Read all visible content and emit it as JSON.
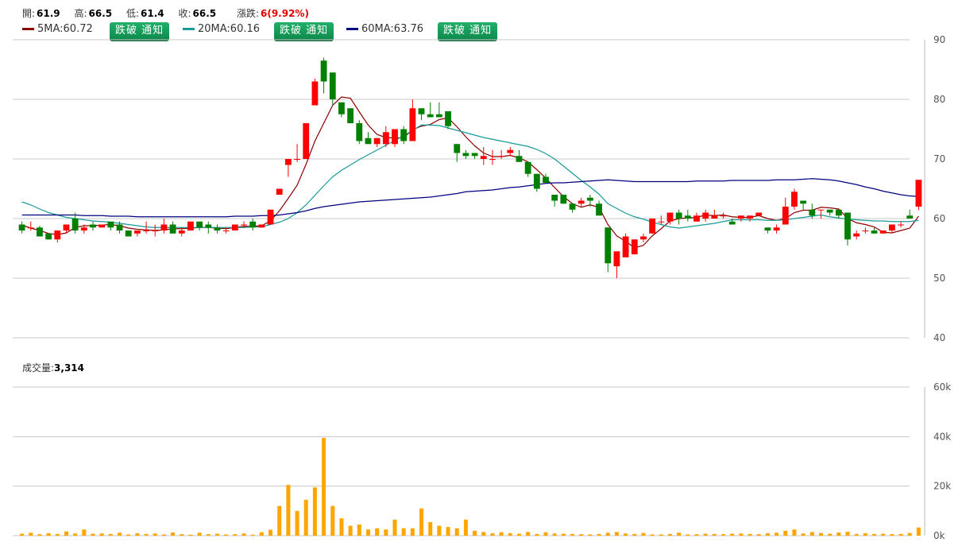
{
  "header": {
    "open_label": "開:",
    "open": "61.9",
    "high_label": "高:",
    "high": "66.5",
    "low_label": "低:",
    "low": "61.4",
    "close_label": "收:",
    "close": "66.5",
    "change_label": "漲跌:",
    "change": "6(9.92%)"
  },
  "ma": [
    {
      "label": "5MA:60.72",
      "color": "#8b0000",
      "button": "跌破 通知"
    },
    {
      "label": "20MA:60.16",
      "color": "#199a9a",
      "button": "跌破 通知"
    },
    {
      "label": "60MA:63.76",
      "color": "#00007f",
      "button": "跌破 通知"
    }
  ],
  "volume_label": "成交量:",
  "volume_value": "3,314",
  "colors": {
    "up": "#ff0000",
    "down": "#008000",
    "volume": "#ffa500",
    "grid": "#c8c8c8"
  },
  "chart_data": [
    {
      "type": "candlestick",
      "ylim": [
        40,
        90
      ],
      "yticks": [
        "90",
        "80",
        "70",
        "60",
        "50",
        "40"
      ],
      "grid": true,
      "candles": [
        [
          59.0,
          59.5,
          57.5,
          58.0
        ],
        [
          58.5,
          59.5,
          58.0,
          58.5
        ],
        [
          58.5,
          58.8,
          57.0,
          57.0
        ],
        [
          57.5,
          57.5,
          56.5,
          56.5
        ],
        [
          56.5,
          58.0,
          56.0,
          58.0
        ],
        [
          58.0,
          59.0,
          57.5,
          59.0
        ],
        [
          60.0,
          61.0,
          57.5,
          58.0
        ],
        [
          58.0,
          59.0,
          57.5,
          58.5
        ],
        [
          59.0,
          59.5,
          58.0,
          58.5
        ],
        [
          58.5,
          59.0,
          58.5,
          59.0
        ],
        [
          59.5,
          59.5,
          58.0,
          58.5
        ],
        [
          59.0,
          59.5,
          57.5,
          58.0
        ],
        [
          58.0,
          58.0,
          57.0,
          57.0
        ],
        [
          57.5,
          58.0,
          57.0,
          58.0
        ],
        [
          58.0,
          59.5,
          57.5,
          58.0
        ],
        [
          58.0,
          59.0,
          57.0,
          58.0
        ],
        [
          58.0,
          60.0,
          57.5,
          59.0
        ],
        [
          59.0,
          59.5,
          57.5,
          57.5
        ],
        [
          57.5,
          58.5,
          57.0,
          58.0
        ],
        [
          58.0,
          59.5,
          58.0,
          59.5
        ],
        [
          59.5,
          59.5,
          58.0,
          58.5
        ],
        [
          59.0,
          59.5,
          57.5,
          58.5
        ],
        [
          58.5,
          59.0,
          57.5,
          58.0
        ],
        [
          58.0,
          58.5,
          57.5,
          58.0
        ],
        [
          58.0,
          59.0,
          58.0,
          59.0
        ],
        [
          59.0,
          59.5,
          58.5,
          59.0
        ],
        [
          59.5,
          60.0,
          58.0,
          58.5
        ],
        [
          58.5,
          59.0,
          58.5,
          59.0
        ],
        [
          59.0,
          61.5,
          59.0,
          61.5
        ],
        [
          64.0,
          65.0,
          64.0,
          65.0
        ],
        [
          69.0,
          70.0,
          67.0,
          70.0
        ],
        [
          70.0,
          72.5,
          69.5,
          70.0
        ],
        [
          70.0,
          76.0,
          70.0,
          76.0
        ],
        [
          79.0,
          83.5,
          79.0,
          83.0
        ],
        [
          86.5,
          87.0,
          81.0,
          83.0
        ],
        [
          84.5,
          84.5,
          79.0,
          80.0
        ],
        [
          79.5,
          79.5,
          77.0,
          77.5
        ],
        [
          78.5,
          78.5,
          76.0,
          76.0
        ],
        [
          76.0,
          76.5,
          72.5,
          73.0
        ],
        [
          73.5,
          74.5,
          72.5,
          72.5
        ],
        [
          72.5,
          73.5,
          72.0,
          73.5
        ],
        [
          72.5,
          75.5,
          72.0,
          74.5
        ],
        [
          72.5,
          75.0,
          72.0,
          75.0
        ],
        [
          75.0,
          75.5,
          72.5,
          73.0
        ],
        [
          73.0,
          80.0,
          73.0,
          78.5
        ],
        [
          78.5,
          78.5,
          76.5,
          77.5
        ],
        [
          77.5,
          79.5,
          77.0,
          77.0
        ],
        [
          77.5,
          79.5,
          77.0,
          77.0
        ],
        [
          78.0,
          78.0,
          75.0,
          75.5
        ],
        [
          72.5,
          72.5,
          69.5,
          71.0
        ],
        [
          71.0,
          71.5,
          70.0,
          70.5
        ],
        [
          71.0,
          71.0,
          70.0,
          70.5
        ],
        [
          70.0,
          72.0,
          69.0,
          70.5
        ],
        [
          70.0,
          71.5,
          69.0,
          70.0
        ],
        [
          70.5,
          71.5,
          70.0,
          70.5
        ],
        [
          71.0,
          72.0,
          70.5,
          71.5
        ],
        [
          70.5,
          71.5,
          70.0,
          69.5
        ],
        [
          69.5,
          69.5,
          67.0,
          67.5
        ],
        [
          67.5,
          67.5,
          64.5,
          65.0
        ],
        [
          67.0,
          67.5,
          66.0,
          66.0
        ],
        [
          64.0,
          64.0,
          62.0,
          63.0
        ],
        [
          64.0,
          64.0,
          62.5,
          62.5
        ],
        [
          62.5,
          62.5,
          61.0,
          61.5
        ],
        [
          62.5,
          63.5,
          62.0,
          63.0
        ],
        [
          63.5,
          64.0,
          62.0,
          63.0
        ],
        [
          62.5,
          63.0,
          60.5,
          60.5
        ],
        [
          58.5,
          58.5,
          51.0,
          52.5
        ],
        [
          52.0,
          54.0,
          50.0,
          54.5
        ],
        [
          53.5,
          57.5,
          53.5,
          57.0
        ],
        [
          54.0,
          56.0,
          54.0,
          56.5
        ],
        [
          56.5,
          57.5,
          56.0,
          57.0
        ],
        [
          57.5,
          60.0,
          57.5,
          60.0
        ],
        [
          59.5,
          60.5,
          59.0,
          59.5
        ],
        [
          59.5,
          61.0,
          59.0,
          61.0
        ],
        [
          61.0,
          61.5,
          59.0,
          60.0
        ],
        [
          60.5,
          61.5,
          59.5,
          60.0
        ],
        [
          59.5,
          61.0,
          59.5,
          60.5
        ],
        [
          60.0,
          61.5,
          59.5,
          61.0
        ],
        [
          60.0,
          61.5,
          60.0,
          60.5
        ],
        [
          60.5,
          61.0,
          60.0,
          60.5
        ],
        [
          59.5,
          60.0,
          59.0,
          59.0
        ],
        [
          60.0,
          60.5,
          59.5,
          60.5
        ],
        [
          60.0,
          60.5,
          59.5,
          60.5
        ],
        [
          60.5,
          61.0,
          60.5,
          61.0
        ],
        [
          58.5,
          58.5,
          57.5,
          58.0
        ],
        [
          58.0,
          59.0,
          57.5,
          58.5
        ],
        [
          59.0,
          63.5,
          59.0,
          62.0
        ],
        [
          62.0,
          65.0,
          61.5,
          64.5
        ],
        [
          63.0,
          63.0,
          61.5,
          62.5
        ],
        [
          61.5,
          62.5,
          60.0,
          60.5
        ],
        [
          61.5,
          61.5,
          60.0,
          61.5
        ],
        [
          61.5,
          61.5,
          60.5,
          61.0
        ],
        [
          61.5,
          61.5,
          60.0,
          60.5
        ],
        [
          61.0,
          61.0,
          55.5,
          56.5
        ],
        [
          57.0,
          58.0,
          56.5,
          57.5
        ],
        [
          58.0,
          58.5,
          57.5,
          58.0
        ],
        [
          58.0,
          58.5,
          57.5,
          57.5
        ],
        [
          57.5,
          58.0,
          57.5,
          58.0
        ],
        [
          58.0,
          59.0,
          57.5,
          59.0
        ],
        [
          59.0,
          59.5,
          58.5,
          59.0
        ],
        [
          60.5,
          61.5,
          60.0,
          60.0
        ],
        [
          62.0,
          66.5,
          61.4,
          66.5
        ]
      ],
      "series": [
        {
          "name": "5MA",
          "values": [
            58.9,
            58.4,
            58.0,
            57.5,
            57.3,
            57.6,
            58.5,
            58.8,
            58.8,
            58.9,
            59.0,
            58.8,
            58.4,
            58.2,
            58.1,
            58.0,
            58.1,
            58.3,
            58.3,
            58.4,
            58.5,
            58.5,
            58.4,
            58.3,
            58.5,
            58.7,
            58.7,
            58.8,
            59.6,
            61.3,
            63.4,
            65.6,
            69.1,
            73.0,
            76.0,
            79.0,
            80.4,
            80.2,
            77.9,
            75.7,
            74.1,
            73.6,
            73.5,
            73.6,
            74.9,
            75.5,
            75.8,
            76.6,
            76.9,
            75.4,
            73.7,
            72.2,
            71.0,
            70.4,
            70.4,
            70.6,
            70.2,
            69.5,
            68.2,
            66.8,
            65.2,
            63.7,
            62.5,
            61.9,
            62.3,
            61.9,
            59.0,
            57.1,
            56.2,
            55.1,
            55.5,
            57.1,
            58.3,
            59.6,
            60.0,
            60.1,
            60.2,
            60.6,
            60.5,
            60.6,
            60.3,
            60.2,
            60.2,
            60.5,
            60.0,
            59.7,
            60.0,
            61.0,
            61.4,
            61.4,
            61.9,
            61.8,
            61.6,
            60.0,
            59.3,
            59.0,
            58.6,
            57.7,
            57.6,
            58.0,
            58.4,
            60.4
          ]
        },
        {
          "name": "20MA",
          "values": [
            62.8,
            62.3,
            61.6,
            61.0,
            60.6,
            60.2,
            60.0,
            59.8,
            59.6,
            59.5,
            59.4,
            59.2,
            59.0,
            58.8,
            58.6,
            58.5,
            58.5,
            58.5,
            58.5,
            58.5,
            58.5,
            58.5,
            58.5,
            58.5,
            58.5,
            58.5,
            58.6,
            58.6,
            59.0,
            59.4,
            60.0,
            61.0,
            62.3,
            63.9,
            65.5,
            67.0,
            68.1,
            69.0,
            69.9,
            70.7,
            71.5,
            72.3,
            73.1,
            73.9,
            74.8,
            75.7,
            75.7,
            75.6,
            75.2,
            74.8,
            74.4,
            74.0,
            73.6,
            73.3,
            73.0,
            72.7,
            72.4,
            72.1,
            71.6,
            70.9,
            70.0,
            68.8,
            67.6,
            66.4,
            65.3,
            64.1,
            62.5,
            61.7,
            60.9,
            60.3,
            59.9,
            59.4,
            59.0,
            58.6,
            58.4,
            58.6,
            58.8,
            59.0,
            59.2,
            59.5,
            59.8,
            59.8,
            59.8,
            59.8,
            59.7,
            59.7,
            59.8,
            60.0,
            60.2,
            60.4,
            60.6,
            60.3,
            60.1,
            59.9,
            59.8,
            59.7,
            59.6,
            59.6,
            59.5,
            59.5,
            59.5,
            59.7
          ]
        },
        {
          "name": "60MA",
          "values": [
            60.6,
            60.6,
            60.6,
            60.6,
            60.6,
            60.6,
            60.6,
            60.5,
            60.5,
            60.5,
            60.4,
            60.4,
            60.4,
            60.3,
            60.3,
            60.3,
            60.3,
            60.3,
            60.3,
            60.3,
            60.3,
            60.3,
            60.3,
            60.3,
            60.4,
            60.4,
            60.4,
            60.5,
            60.5,
            60.6,
            60.8,
            61.0,
            61.3,
            61.7,
            62.0,
            62.2,
            62.4,
            62.6,
            62.8,
            62.9,
            63.0,
            63.1,
            63.2,
            63.3,
            63.4,
            63.5,
            63.6,
            63.8,
            64.0,
            64.2,
            64.5,
            64.6,
            64.7,
            64.8,
            65.0,
            65.2,
            65.3,
            65.5,
            65.7,
            65.9,
            66.0,
            66.0,
            66.1,
            66.2,
            66.3,
            66.4,
            66.5,
            66.4,
            66.3,
            66.2,
            66.2,
            66.2,
            66.2,
            66.2,
            66.2,
            66.2,
            66.3,
            66.3,
            66.3,
            66.3,
            66.4,
            66.4,
            66.4,
            66.4,
            66.4,
            66.5,
            66.5,
            66.5,
            66.6,
            66.7,
            66.6,
            66.5,
            66.3,
            66.0,
            65.7,
            65.3,
            65.0,
            64.6,
            64.3,
            64.0,
            63.8,
            63.7
          ]
        }
      ]
    },
    {
      "type": "bar",
      "ylim": [
        0,
        60000
      ],
      "yticks": [
        "60k",
        "40k",
        "20k",
        "0k"
      ],
      "grid": true,
      "values": [
        800,
        1200,
        600,
        1000,
        700,
        1700,
        900,
        2500,
        800,
        900,
        700,
        1200,
        500,
        1000,
        700,
        900,
        500,
        1300,
        600,
        400,
        1200,
        600,
        800,
        500,
        600,
        900,
        400,
        1400,
        2400,
        12000,
        20500,
        10000,
        14500,
        19500,
        39500,
        12000,
        7000,
        4000,
        4500,
        2500,
        3000,
        2500,
        6500,
        3000,
        3000,
        11000,
        5500,
        4000,
        3500,
        3000,
        6500,
        2000,
        1500,
        1000,
        1400,
        1000,
        800,
        1500,
        700,
        1400,
        900,
        800,
        700,
        600,
        500,
        700,
        1200,
        1500,
        900,
        700,
        1100,
        500,
        500,
        700,
        1200,
        500,
        600,
        800,
        700,
        600,
        800,
        900,
        700,
        600,
        1000,
        1200,
        2000,
        2500,
        900,
        1500,
        1100,
        800,
        1300,
        1600,
        700,
        1000,
        700,
        800,
        600,
        700,
        1100,
        3314
      ]
    }
  ]
}
